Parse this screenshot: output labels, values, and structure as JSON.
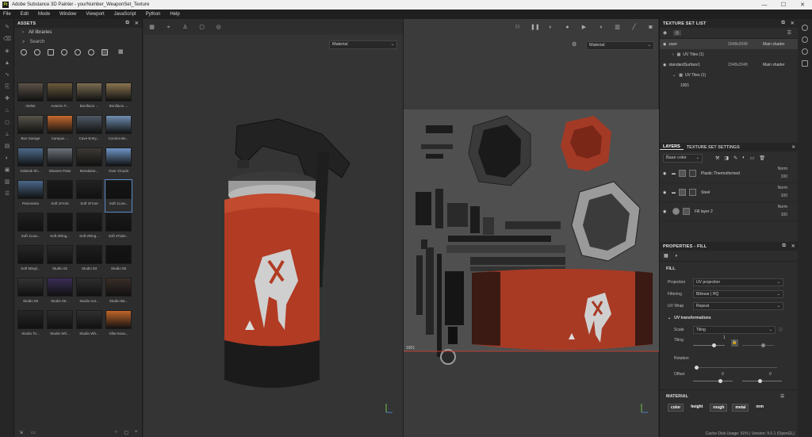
{
  "titlebar": {
    "title": "Adobe Substance 3D Painter - yourNumber_WeaponSet_Texture",
    "logo": "Pt",
    "minimize": "—",
    "maximize": "☐",
    "close": "✕"
  },
  "menu": [
    "File",
    "Edit",
    "Mode",
    "Window",
    "Viewport",
    "JavaScript",
    "Python",
    "Help"
  ],
  "assets": {
    "title": "ASSETS",
    "library": "All libraries",
    "search_placeholder": "Search",
    "items": [
      {
        "label": "Atelier",
        "color": "#5b5248"
      },
      {
        "label": "Autumn F...",
        "color": "#6b5a3c"
      },
      {
        "label": "Bonifacio ...",
        "color": "#7a6c52"
      },
      {
        "label": "Bonifacio ...",
        "color": "#8a7450"
      },
      {
        "label": "Bus Garage",
        "color": "#57544a"
      },
      {
        "label": "Campus ...",
        "color": "#c56a2e"
      },
      {
        "label": "Cave Entry...",
        "color": "#4f5a66"
      },
      {
        "label": "Corsica Be...",
        "color": "#6f8eb0"
      },
      {
        "label": "Gdansk Sh...",
        "color": "#4c6a8a"
      },
      {
        "label": "Glasses Patio",
        "color": "#6a7178"
      },
      {
        "label": "Mondaine...",
        "color": "#3e3b36"
      },
      {
        "label": "Over Clouds",
        "color": "#6f94c6"
      },
      {
        "label": "Panorama",
        "color": "#4a6888"
      },
      {
        "label": "Soft 1Front",
        "color": "#1a1a1a"
      },
      {
        "label": "Soft 1Front",
        "color": "#222222"
      },
      {
        "label": "Soft 1Low...",
        "color": "#151515"
      },
      {
        "label": "Soft 1Low...",
        "color": "#202020"
      },
      {
        "label": "Soft 2Ring...",
        "color": "#181818"
      },
      {
        "label": "Soft 2Ring...",
        "color": "#1c1c1c"
      },
      {
        "label": "Soft 4Tube...",
        "color": "#1a1a1a"
      },
      {
        "label": "Soft 5Dayl...",
        "color": "#262626"
      },
      {
        "label": "Studio 02",
        "color": "#2a2a2a"
      },
      {
        "label": "Studio 03",
        "color": "#1e1e1e"
      },
      {
        "label": "Studio 05",
        "color": "#141414"
      },
      {
        "label": "Studio 06",
        "color": "#333333"
      },
      {
        "label": "Studio 06...",
        "color": "#3a2d55"
      },
      {
        "label": "Studio Aut...",
        "color": "#2e2e2e"
      },
      {
        "label": "Studio Ba...",
        "color": "#3a2e28"
      },
      {
        "label": "Studio To...",
        "color": "#262626"
      },
      {
        "label": "Studio Wh...",
        "color": "#2c2c2c"
      },
      {
        "label": "Studio Wh...",
        "color": "#303030"
      },
      {
        "label": "Villa Nova...",
        "color": "#c0652a"
      }
    ]
  },
  "viewport3d": {
    "material_select": "Material"
  },
  "viewport2d": {
    "material_select": "Material",
    "udim_label": "1001"
  },
  "texture_set_list": {
    "title": "TEXTURE SET LIST",
    "rows": [
      {
        "name": "zaze",
        "size": "2048x2048",
        "shader": "Main shader"
      },
      {
        "name": "UV Tiles (1)",
        "size": "",
        "shader": ""
      },
      {
        "name": "standardSurface1",
        "size": "2048x2048",
        "shader": "Main shader"
      },
      {
        "name": "UV Tiles (1)",
        "size": "",
        "shader": ""
      },
      {
        "name": "1001",
        "size": "",
        "shader": ""
      }
    ]
  },
  "layers": {
    "tab_layers": "LAYERS",
    "tab_settings": "TEXTURE SET SETTINGS",
    "channel": "Base color",
    "items": [
      {
        "name": "Plastic Thermoformed",
        "blend": "Norm",
        "opacity": "100"
      },
      {
        "name": "Steel",
        "blend": "Norm",
        "opacity": "100"
      },
      {
        "name": "Fill layer 2",
        "blend": "Norm",
        "opacity": "100"
      }
    ]
  },
  "properties": {
    "title": "PROPERTIES - FILL",
    "section": "FILL",
    "projection_label": "Projection",
    "projection_value": "UV projection",
    "filtering_label": "Filtering",
    "filtering_value": "Bilinear | HQ",
    "uvwrap_label": "UV Wrap",
    "uvwrap_value": "Repeat",
    "uvt_label": "UV transformations",
    "scale_label": "Scale",
    "scale_value": "Tiling",
    "tiling_label": "Tiling",
    "tiling_value": "1",
    "rotation_label": "Rotation",
    "offset_label": "Offset",
    "offset_x": "0",
    "offset_y": "0",
    "material_section": "MATERIAL",
    "channels": [
      "color",
      "height",
      "rough",
      "metal",
      "nrm"
    ]
  },
  "status": "Cache Disk Usage:  91% | Version: 9.0.1 (OpenGL)"
}
